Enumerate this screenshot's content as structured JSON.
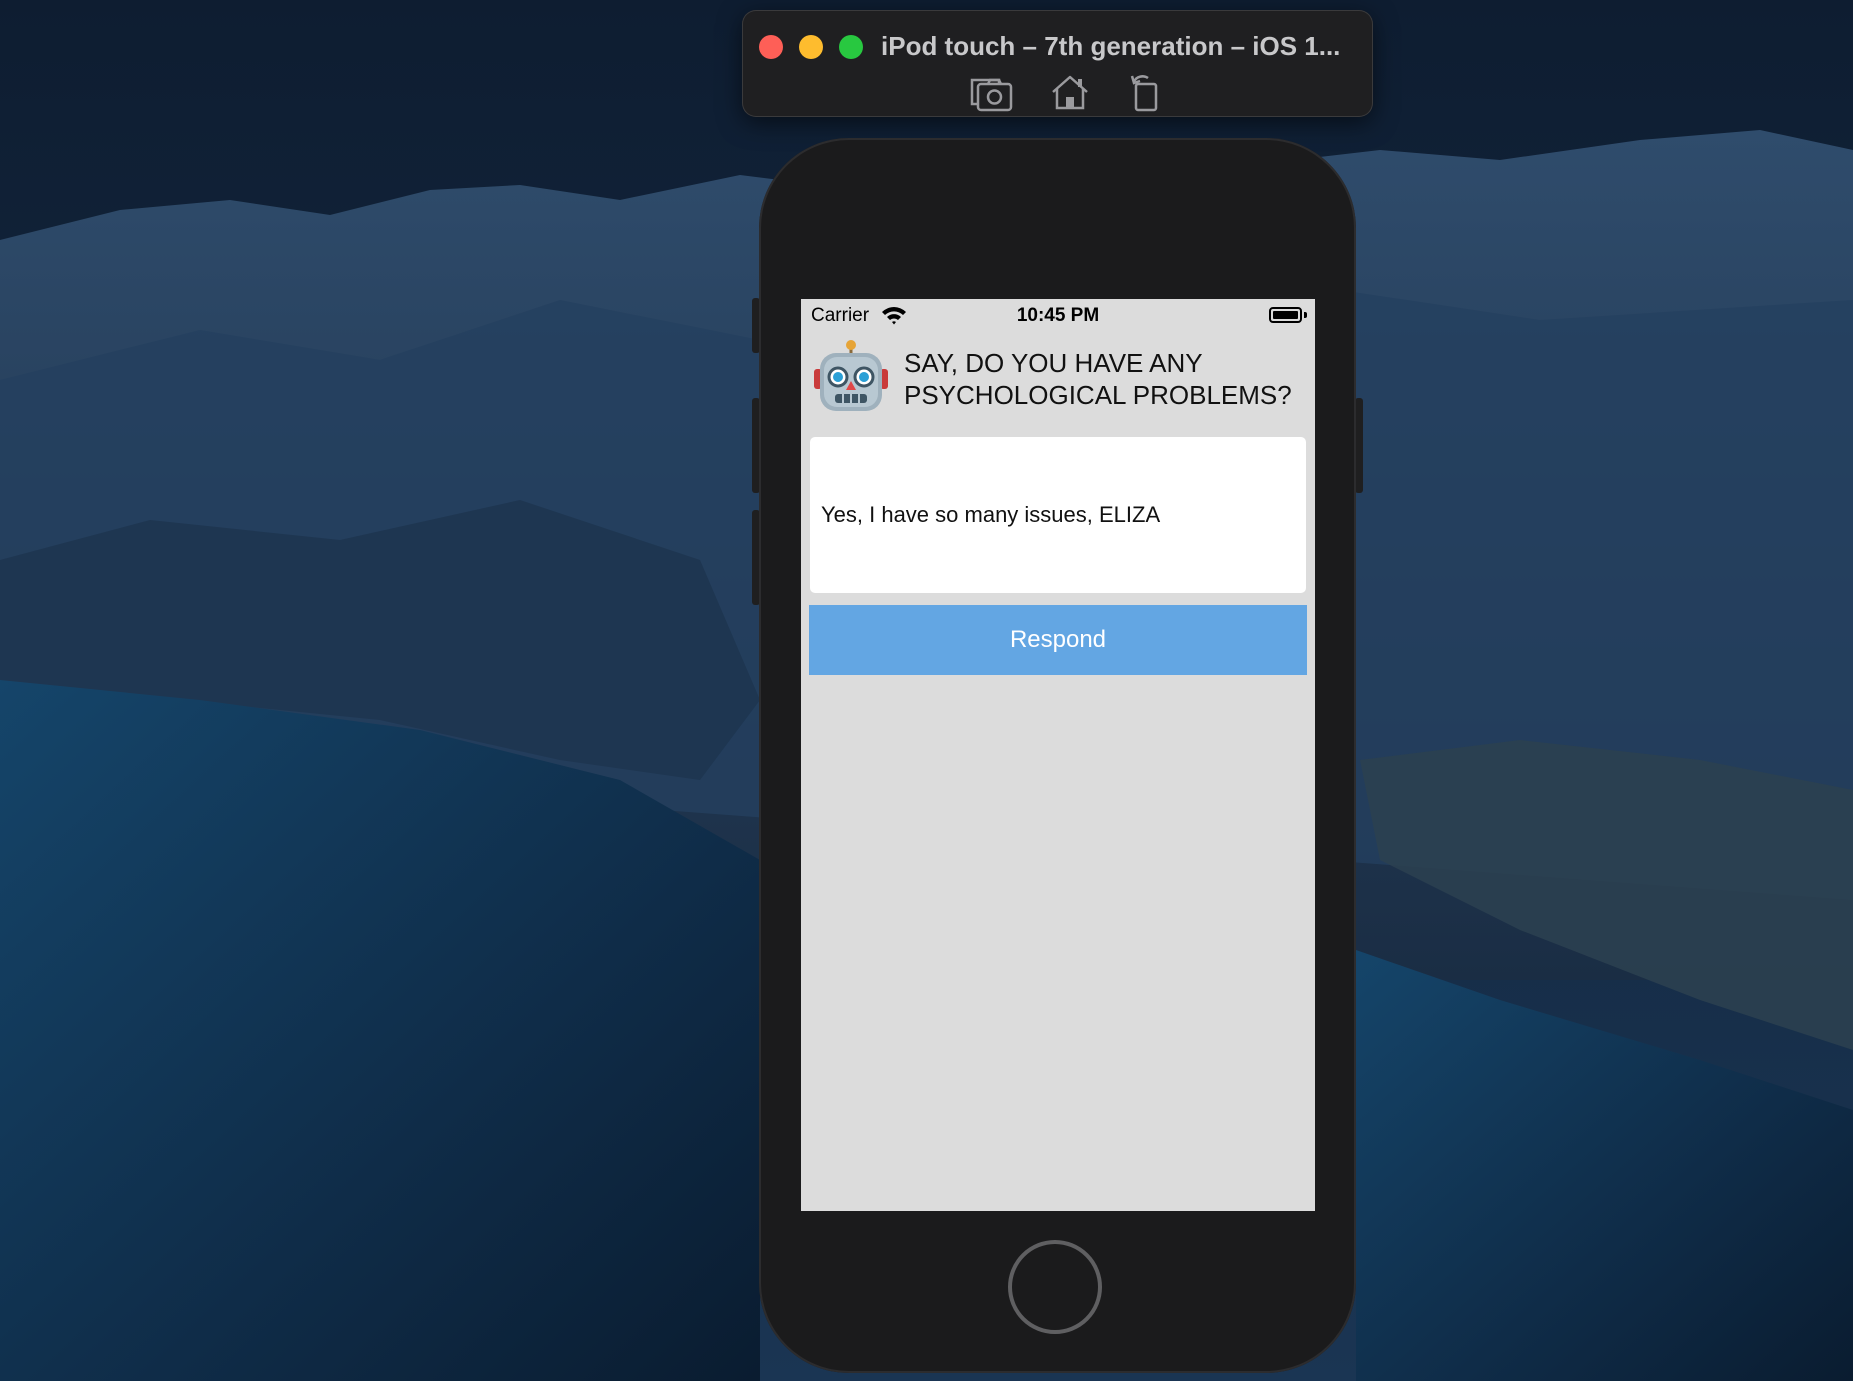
{
  "desktop": {
    "wallpaper": "coastal-mountains-night"
  },
  "simulator": {
    "title": "iPod touch – 7th generation – iOS 1...",
    "toolbar_icons": [
      "screenshot-icon",
      "home-icon",
      "rotate-icon"
    ]
  },
  "status_bar": {
    "carrier": "Carrier",
    "time": "10:45 PM",
    "wifi_icon": "wifi-icon",
    "battery_icon": "battery-icon"
  },
  "app": {
    "avatar_icon": "robot-icon",
    "prompt": "SAY, DO YOU HAVE ANY PSYCHOLOGICAL PROBLEMS?",
    "answer_value": "Yes, I have so many issues, ELIZA",
    "respond_label": "Respond"
  },
  "colors": {
    "screen_bg": "#dcdcdc",
    "button_bg": "#63a6e3",
    "button_text": "#ffffff",
    "device_body": "#1b1b1c"
  }
}
